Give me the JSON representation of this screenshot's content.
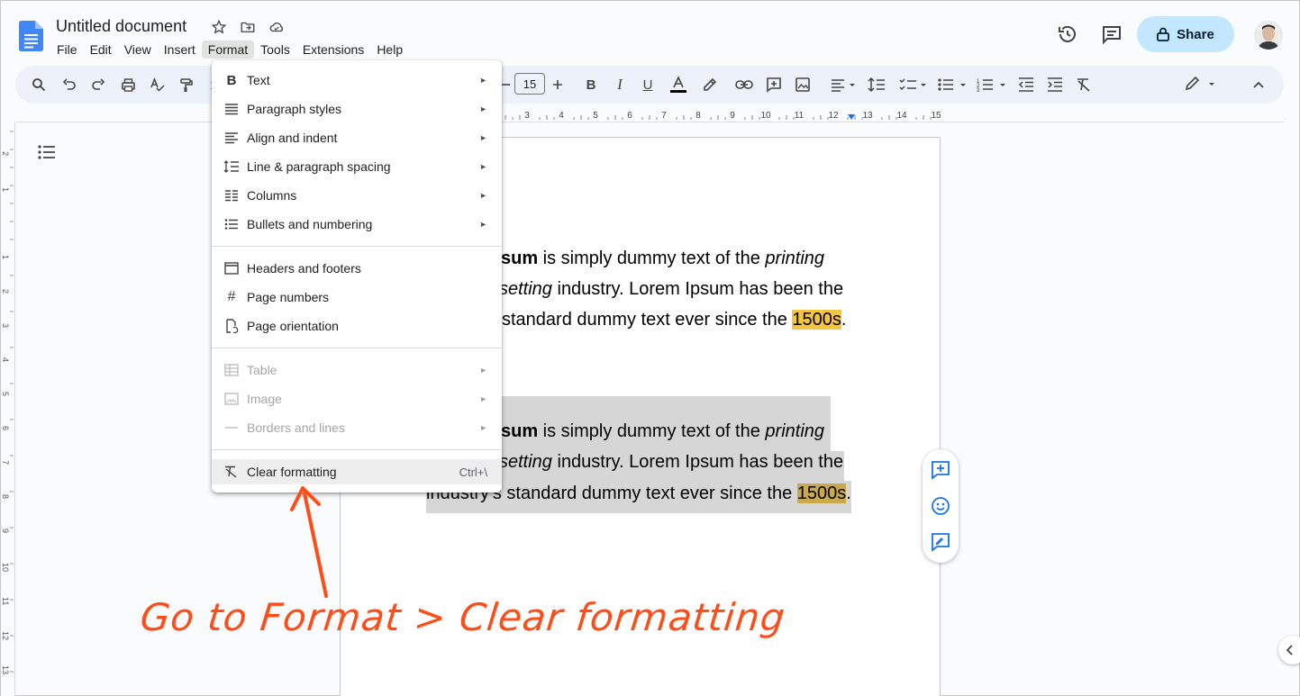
{
  "doc": {
    "title": "Untitled document",
    "menus": [
      "File",
      "Edit",
      "View",
      "Insert",
      "Format",
      "Tools",
      "Extensions",
      "Help"
    ],
    "share_label": "Share"
  },
  "toolbar": {
    "font_size": "15",
    "zoom_partial": "1"
  },
  "ruler": {
    "ticks": [
      "3",
      "4",
      "5",
      "6",
      "7",
      "8",
      "9",
      "10",
      "11",
      "12",
      "13",
      "14",
      "15"
    ]
  },
  "left_ruler": {
    "ticks": [
      "2",
      "1",
      "1",
      "2",
      "3",
      "4",
      "5",
      "6",
      "7",
      "8",
      "9",
      "10",
      "11",
      "12",
      "13"
    ]
  },
  "format_menu": {
    "items": [
      {
        "label": "Text",
        "icon": "bold-icon",
        "submenu": true
      },
      {
        "label": "Paragraph styles",
        "icon": "paragraph-styles-icon",
        "submenu": true
      },
      {
        "label": "Align and indent",
        "icon": "align-icon",
        "submenu": true
      },
      {
        "label": "Line & paragraph spacing",
        "icon": "line-spacing-icon",
        "submenu": true
      },
      {
        "label": "Columns",
        "icon": "columns-icon",
        "submenu": true
      },
      {
        "label": "Bullets and numbering",
        "icon": "bullets-icon",
        "submenu": true
      },
      {
        "label": "Headers and footers",
        "icon": "header-footer-icon",
        "submenu": false
      },
      {
        "label": "Page numbers",
        "icon": "hash-icon",
        "submenu": false
      },
      {
        "label": "Page orientation",
        "icon": "page-orientation-icon",
        "submenu": false
      },
      {
        "label": "Table",
        "icon": "table-icon",
        "submenu": true,
        "disabled": true
      },
      {
        "label": "Image",
        "icon": "image-icon",
        "submenu": true,
        "disabled": true
      },
      {
        "label": "Borders and lines",
        "icon": "border-icon",
        "submenu": true,
        "disabled": true
      },
      {
        "label": "Clear formatting",
        "icon": "clear-formatting-icon",
        "shortcut": "Ctrl+\\"
      }
    ]
  },
  "content": {
    "para1_l1_bold": "sum",
    "para1_l1_rest": " is simply dummy text of the ",
    "para1_l1_ital": "printing",
    "para1_l2_ital": "setting",
    "para1_l2_rest": " industry. Lorem Ipsum has been the",
    "para1_l3_pre": " standard dummy text ever since the ",
    "para1_l3_hl": "1500s",
    "para1_l3_post": ".",
    "para2_l1_bold": "sum",
    "para2_l1_rest": " is simply dummy text of the ",
    "para2_l1_ital": "printing",
    "para2_l2_ital": "setting",
    "para2_l2_rest": " industry. Lorem Ipsum has been the",
    "para2_l3_pre": "industry's standard dummy text ever since the ",
    "para2_l3_hl": "1500s",
    "para2_l3_post": "."
  },
  "annotation": {
    "text": "Go to Format > Clear formatting",
    "color": "#ff4d1a"
  },
  "colors": {
    "accent": "#c2e7ff",
    "highlight": "#f4c542",
    "docs_blue": "#4285f4"
  }
}
